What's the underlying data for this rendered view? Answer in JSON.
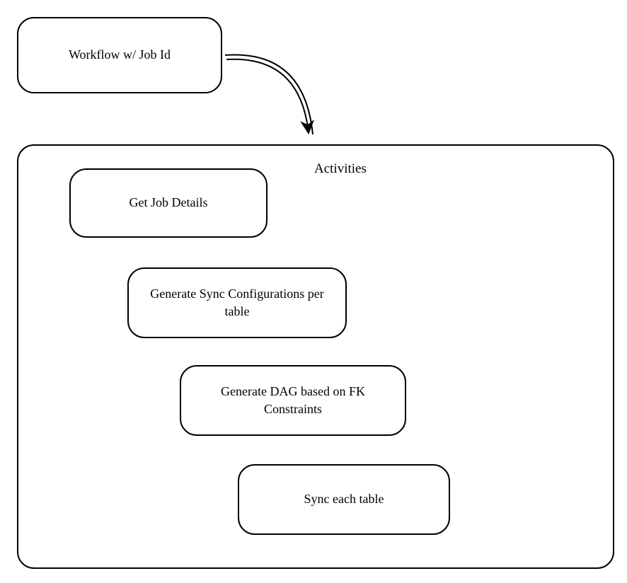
{
  "diagram": {
    "workflow_node": "Workflow w/ Job Id",
    "container_label": "Activities",
    "activities": [
      "Get Job Details",
      "Generate Sync Configurations per table",
      "Generate DAG based on FK Constraints",
      "Sync each table"
    ]
  }
}
